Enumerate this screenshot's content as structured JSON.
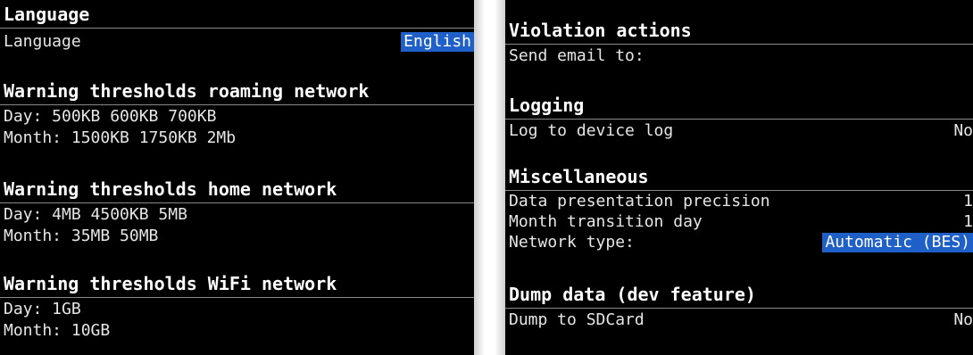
{
  "left_screen": {
    "language_section": {
      "header": "Language",
      "row_label": "Language",
      "row_value": "English"
    },
    "roaming_section": {
      "header": "Warning thresholds roaming network",
      "day": "Day: 500KB 600KB 700KB",
      "month": "Month: 1500KB 1750KB 2Mb"
    },
    "home_section": {
      "header": "Warning thresholds home network",
      "day": "Day: 4MB 4500KB 5MB",
      "month": "Month: 35MB 50MB"
    },
    "wifi_section": {
      "header": "Warning thresholds WiFi network",
      "day": "Day: 1GB",
      "month": "Month: 10GB"
    }
  },
  "right_screen": {
    "violation_section": {
      "header": "Violation actions",
      "row_label": "Send email to:"
    },
    "logging_section": {
      "header": "Logging",
      "row_label": "Log to device log",
      "row_value": "No"
    },
    "misc_section": {
      "header": "Miscellaneous",
      "precision_label": "Data presentation precision",
      "precision_value": "1",
      "transition_label": "Month transition day",
      "transition_value": "1",
      "network_label": "Network type:",
      "network_value": "Automatic (BES)"
    },
    "dump_section": {
      "header": "Dump data (dev feature)",
      "row_label": "Dump to SDCard",
      "row_value": "No"
    }
  },
  "colors": {
    "background": "#000000",
    "text": "#ffffff",
    "selection": "#1f5fc8",
    "divider": "#8a8a8a"
  }
}
